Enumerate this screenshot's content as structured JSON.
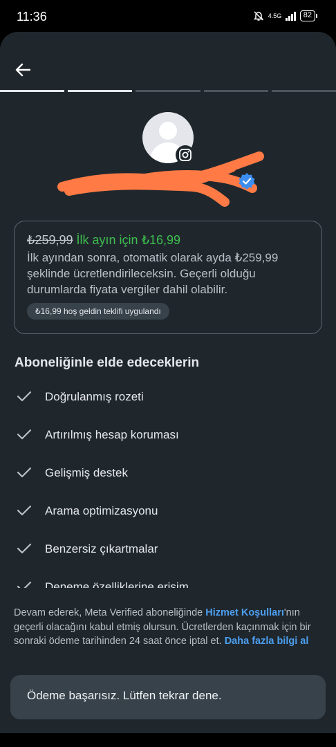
{
  "status_bar": {
    "time": "11:36",
    "network": "4.5G",
    "battery": "82"
  },
  "header": {
    "back_icon": "arrow-left-icon",
    "progress_total": 5,
    "progress_completed": 2
  },
  "profile": {
    "avatar_icon": "default-avatar-icon",
    "badge_icon": "instagram-icon",
    "verified_icon": "verified-badge-icon"
  },
  "pricing": {
    "old_price": "₺259,99",
    "promo": "İlk ayın için ₺16,99",
    "description": "İlk ayından sonra, otomatik olarak ayda ₺259,99 şeklinde ücretlendirileceksin. Geçerli olduğu durumlarda fiyata vergiler dahil olabilir.",
    "offer_chip": "₺16,99 hoş geldin teklifi uygulandı"
  },
  "benefits": {
    "title": "Aboneliğinle elde edeceklerin",
    "items": [
      "Doğrulanmış rozeti",
      "Artırılmış hesap koruması",
      "Gelişmiş destek",
      "Arama optimizasyonu",
      "Benzersiz çıkartmalar",
      "Deneme özelliklerine erişim"
    ]
  },
  "legal": {
    "part1": "Devam ederek, Meta Verified aboneliğinde ",
    "terms_link": "Hizmet Koşulları",
    "part2": "'nın geçerli olacağını kabul etmiş olursun. Ücretlerden kaçınmak için bir sonraki ödeme tarihinden 24 saat önce iptal et. ",
    "more_link": "Daha fazla bilgi al"
  },
  "toast": {
    "message": "Ödeme başarısız. Lütfen tekrar dene."
  },
  "colors": {
    "background": "#1f272d",
    "promo_green": "#3fbe4f",
    "link_blue": "#4d9ff0",
    "verified_blue": "#3b8ef0",
    "redaction_orange": "#ff7a45"
  }
}
